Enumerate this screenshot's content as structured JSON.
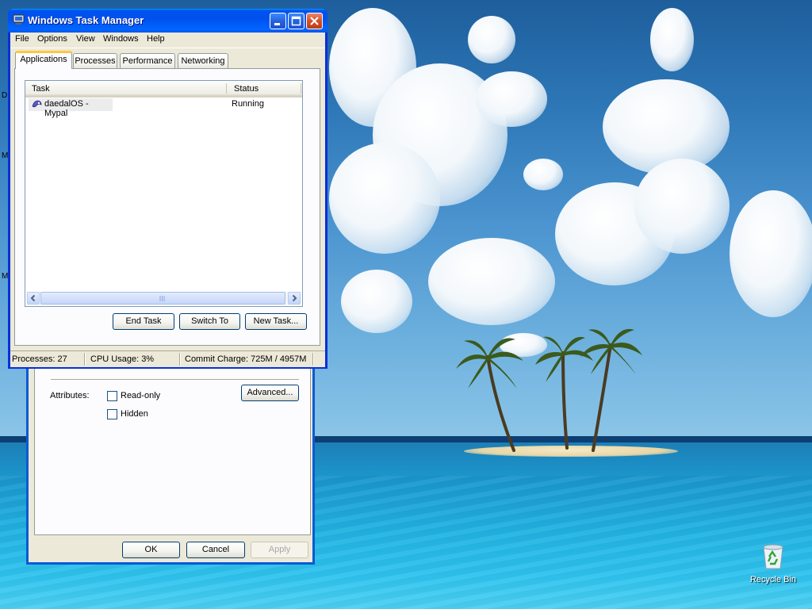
{
  "desktop": {
    "recycle_bin_label": "Recycle Bin",
    "edge_letters": [
      "D",
      "M",
      "M"
    ]
  },
  "task_manager": {
    "title": "Windows Task Manager",
    "menu": [
      "File",
      "Options",
      "View",
      "Windows",
      "Help"
    ],
    "tabs": [
      "Applications",
      "Processes",
      "Performance",
      "Networking"
    ],
    "active_tab": "Applications",
    "columns": [
      "Task",
      "Status"
    ],
    "tasks": [
      {
        "name": "daedalOS - Mypal",
        "status": "Running"
      }
    ],
    "buttons": {
      "end_task": "End Task",
      "switch_to": "Switch To",
      "new_task": "New Task..."
    },
    "status": {
      "processes": "Processes: 27",
      "cpu": "CPU Usage: 3%",
      "commit": "Commit Charge: 725M / 4957M"
    }
  },
  "properties_dialog": {
    "attributes_label": "Attributes:",
    "read_only_label": "Read-only",
    "read_only_checked": false,
    "hidden_label": "Hidden",
    "hidden_checked": false,
    "advanced_label": "Advanced...",
    "ok_label": "OK",
    "cancel_label": "Cancel",
    "apply_label": "Apply"
  },
  "colors": {
    "titlebar": "#0053ee",
    "window_face": "#ece9d8",
    "active_tab_accent": "#ffc83c"
  }
}
